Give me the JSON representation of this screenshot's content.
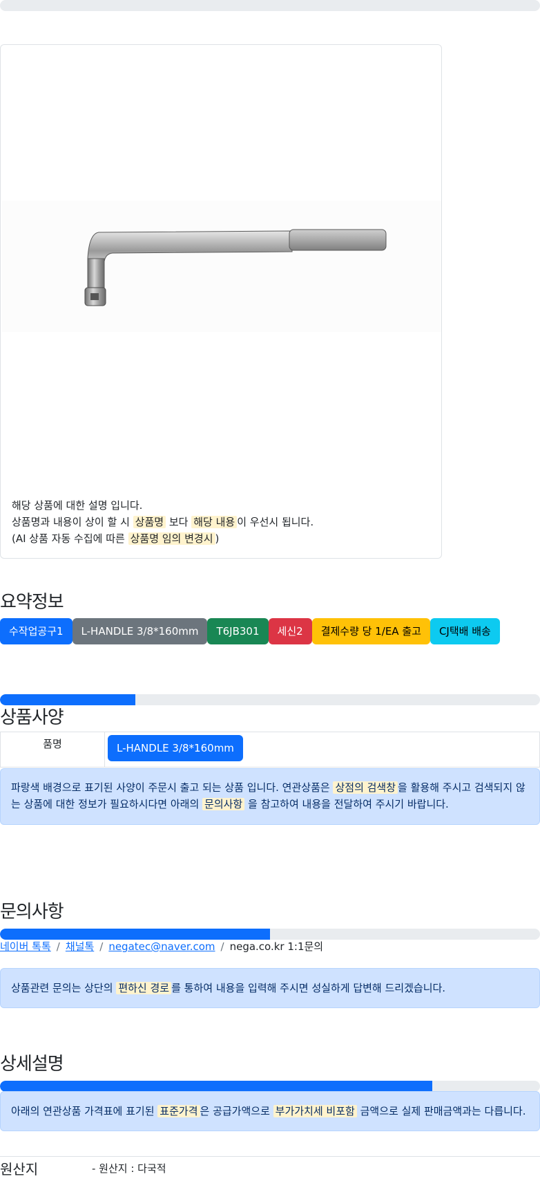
{
  "top_progress": {
    "value_percent": 0
  },
  "product_card": {
    "image_alt": "L-HANDLE socket wrench",
    "desc_line1": "해당 상품에 대한 설명 입니다.",
    "desc_line2_a": "상품명과 내용이 상이 할 시",
    "desc_line2_hl1": "상품명",
    "desc_line2_b": "보다",
    "desc_line2_hl2": "해당 내용",
    "desc_line2_c": "이 우선시 됩니다.",
    "desc_line3_a": "(AI 상품 자동 수집에 따른",
    "desc_line3_hl": "상품명 임의 변경시",
    "desc_line3_b": ")"
  },
  "summary": {
    "title": "요약정보",
    "badges": [
      "수작업공구1",
      "L-HANDLE 3/8*160mm",
      "T6JB301",
      "세신2",
      "결제수량 당 1/EA 출고",
      "CJ택배 배송"
    ],
    "progress_percent": 25
  },
  "spec": {
    "title": "상품사양",
    "rows": [
      {
        "key": "품명",
        "value": "L-HANDLE 3/8*160mm"
      }
    ],
    "note_a": "파랑색 배경으로 표기된 사양이 주문시 출고 되는 상품 입니다. 연관상품은",
    "note_hl1": "상점의 검색창",
    "note_b": "을 활용해 주시고 검색되지 않는 상품에 대한 정보가 필요하시다면 아래의",
    "note_hl2": "문의사항",
    "note_c": "을 참고하여 내용을 전달하여 주시기 바랍니다."
  },
  "inquiry": {
    "title": "문의사항",
    "progress_percent": 50,
    "links": [
      "네이버 톡톡",
      "채널톡",
      "negatec@naver.com"
    ],
    "plain_link": "nega.co.kr 1:1문의",
    "note_a": "상품관련 문의는 상단의",
    "note_hl": "편하신 경로",
    "note_b": "를 통하여 내용을 입력해 주시면 성실하게 답변해 드리겠습니다."
  },
  "detail": {
    "title": "상세설명",
    "progress_percent": 80,
    "note_a": "아래의 연관상품 가격표에 표기된",
    "note_hl1": "표준가격",
    "note_b": "은 공급가액으로",
    "note_hl2": "부가가치세 비포함",
    "note_c": "금액으로 실제 판매금액과는 다릅니다."
  },
  "origin": {
    "label": "원산지",
    "value": "- 원산지 : 다국적"
  },
  "colors": {
    "primary": "#0d6efd",
    "info_bg": "#cfe2ff",
    "highlight": "#fff3cd"
  }
}
